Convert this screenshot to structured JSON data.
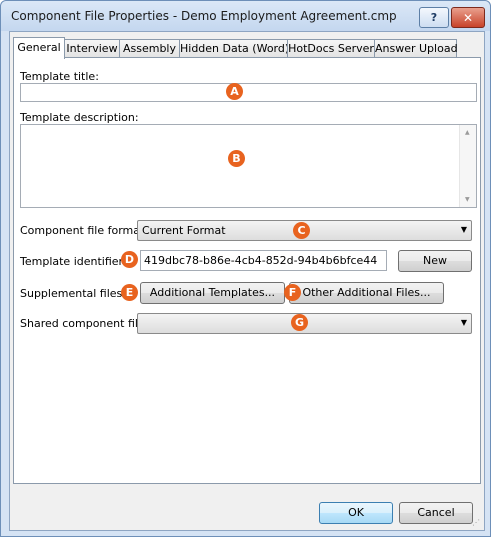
{
  "window": {
    "title": "Component File Properties - Demo Employment Agreement.cmp",
    "help_label": "?",
    "close_label": "✕"
  },
  "tabs": [
    {
      "label": "General",
      "active": true
    },
    {
      "label": "Interview"
    },
    {
      "label": "Assembly"
    },
    {
      "label": "Hidden Data (Word)"
    },
    {
      "label": "HotDocs Server"
    },
    {
      "label": "Answer Upload"
    }
  ],
  "general": {
    "template_title_label": "Template title:",
    "template_title_value": "",
    "template_description_label": "Template description:",
    "template_description_value": "",
    "component_file_format_label": "Component file format:",
    "component_file_format_value": "Current Format",
    "template_identifier_label": "Template identifier:",
    "template_identifier_value": "419dbc78-b86e-4cb4-852d-94b4b6bfce44",
    "new_button": "New",
    "supplemental_files_label": "Supplemental files:",
    "additional_templates_button": "Additional Templates...",
    "other_additional_files_button": "Other Additional Files...",
    "shared_component_file_label": "Shared component file:",
    "shared_component_file_value": ""
  },
  "markers": [
    "A",
    "B",
    "C",
    "D",
    "E",
    "F",
    "G"
  ],
  "footer": {
    "ok_button": "OK",
    "cancel_button": "Cancel"
  },
  "colors": {
    "marker": "#e8631f",
    "title_bar": "#c4d7ef",
    "close_button": "#c8432a"
  }
}
